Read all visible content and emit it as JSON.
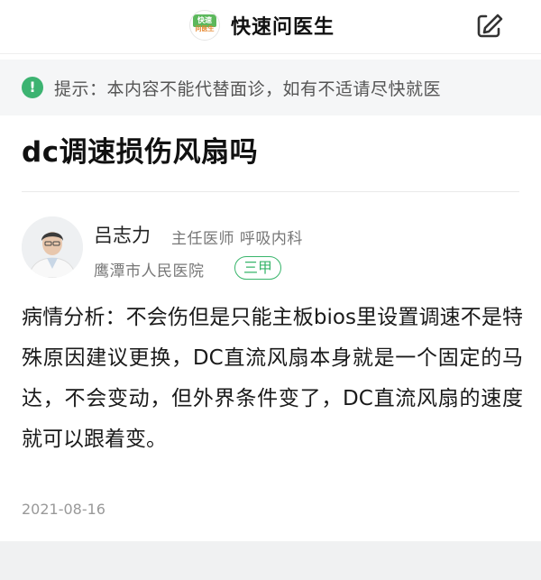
{
  "header": {
    "logo_top": "快速",
    "logo_bottom": "问医生",
    "app_name": "快速问医生",
    "edit_icon": "edit-icon",
    "accent_color": "#5cb85c"
  },
  "notice": {
    "icon": "exclamation-info-icon",
    "text": "提示：本内容不能代替面诊，如有不适请尽快就医"
  },
  "question": {
    "title": "dc调速损伤风扇吗"
  },
  "doctor": {
    "name": "吕志力",
    "title_dept": "主任医师 呼吸内科",
    "hospital": "鹰潭市人民医院",
    "grade": "三甲"
  },
  "answer": {
    "analysis": "病情分析：不会伤但是只能主板bios里设置调速不是特殊原因建议更换，DC直流风扇本身就是一个固定的马达，不会变动，但外界条件变了，DC直流风扇的速度就可以跟着变。",
    "date": "2021-08-16"
  }
}
